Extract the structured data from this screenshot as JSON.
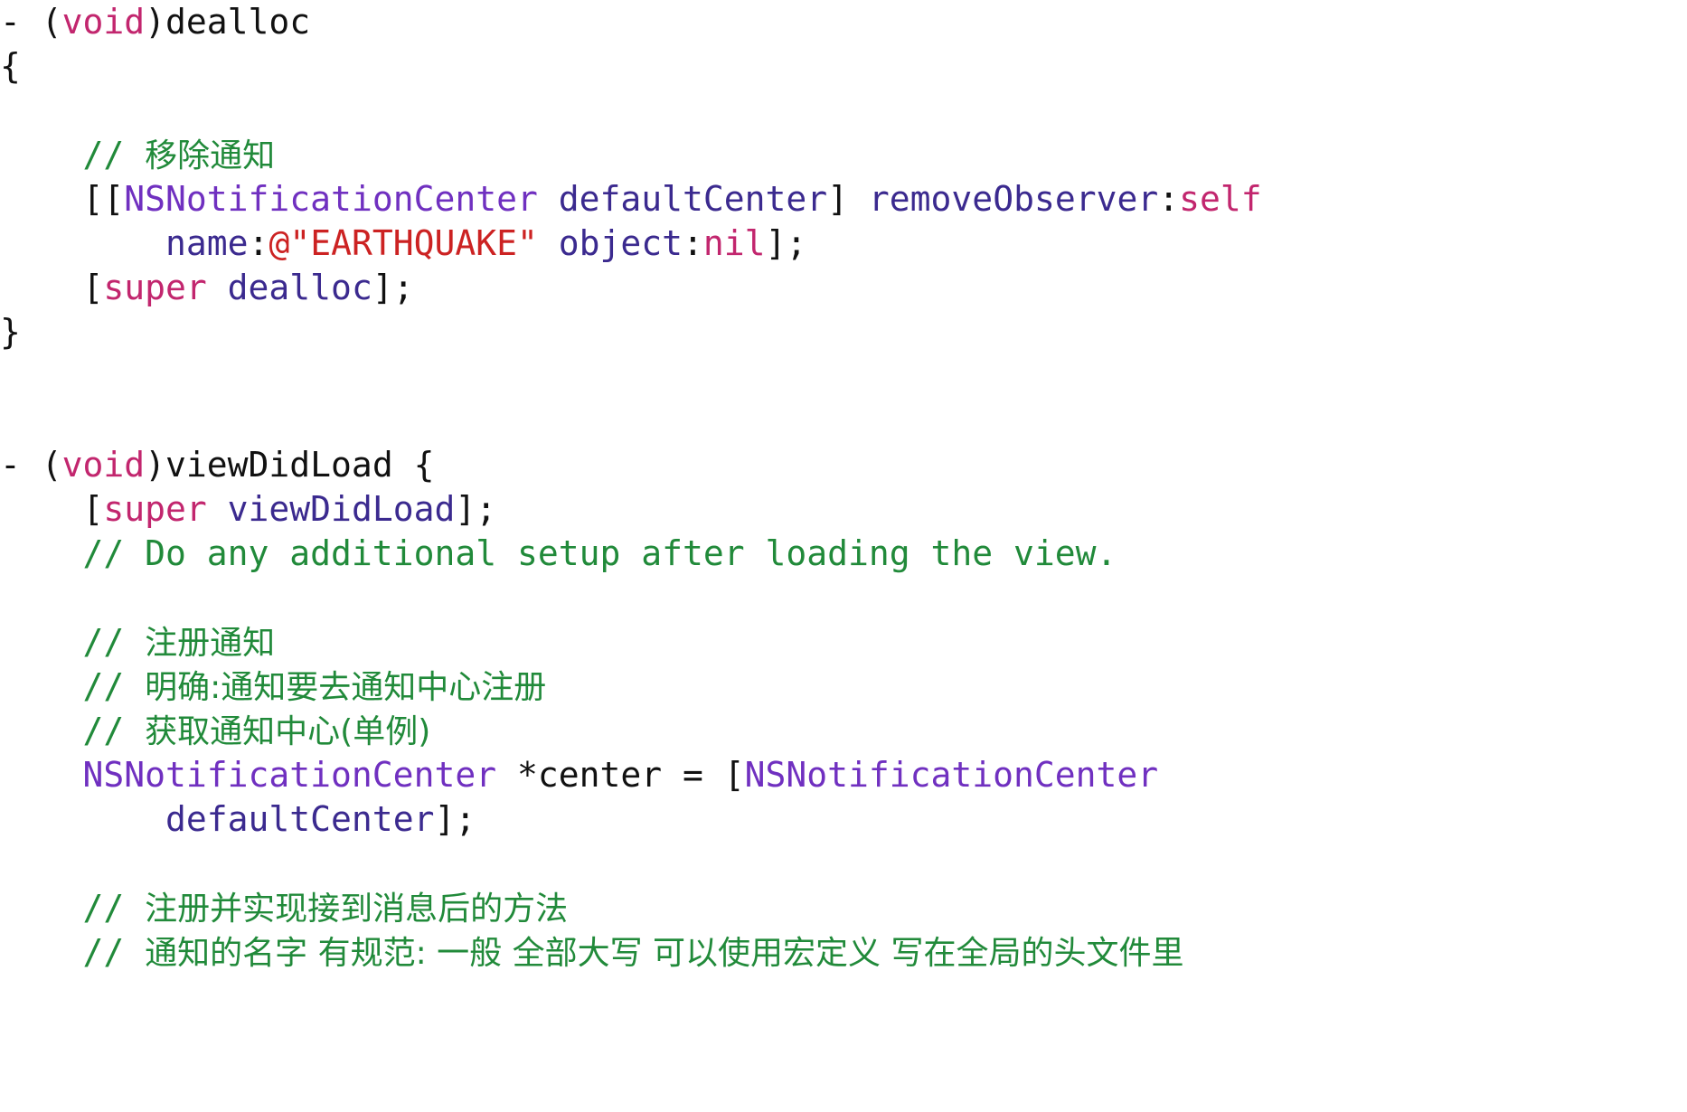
{
  "editor": {
    "language": "Objective-C",
    "background_color": "#ffffff",
    "font_size_px": 38,
    "line_height_px": 49,
    "theme_colors": {
      "keyword": "#c2266e",
      "class_name": "#7030c0",
      "method": "#3b2a8f",
      "comment": "#218a3a",
      "string": "#cc2222",
      "plain": "#111111"
    }
  },
  "code_lines": [
    {
      "index": 0,
      "indent": 0,
      "text": "- (void)dealloc",
      "tokens": [
        {
          "t": "- (",
          "c": "pl"
        },
        {
          "t": "void",
          "c": "kw"
        },
        {
          "t": ")dealloc",
          "c": "pl"
        }
      ]
    },
    {
      "index": 1,
      "indent": 0,
      "text": "{",
      "tokens": [
        {
          "t": "{",
          "c": "pl"
        }
      ]
    },
    {
      "index": 2,
      "indent": 0,
      "text": "",
      "tokens": []
    },
    {
      "index": 3,
      "indent": 4,
      "text": "    // 移除通知",
      "tokens": [
        {
          "t": "    ",
          "c": "pl"
        },
        {
          "t": "// ",
          "c": "cmt"
        },
        {
          "t": "移除通知",
          "c": "cmt-cjk"
        }
      ]
    },
    {
      "index": 4,
      "indent": 4,
      "text": "    [[NSNotificationCenter defaultCenter] removeObserver:self",
      "tokens": [
        {
          "t": "    [[",
          "c": "pl"
        },
        {
          "t": "NSNotificationCenter",
          "c": "cls"
        },
        {
          "t": " ",
          "c": "pl"
        },
        {
          "t": "defaultCenter",
          "c": "mth"
        },
        {
          "t": "] ",
          "c": "pl"
        },
        {
          "t": "removeObserver",
          "c": "mth"
        },
        {
          "t": ":",
          "c": "pl"
        },
        {
          "t": "self",
          "c": "kw"
        }
      ]
    },
    {
      "index": 5,
      "indent": 8,
      "text": "        name:@\"EARTHQUAKE\" object:nil];",
      "tokens": [
        {
          "t": "        ",
          "c": "pl"
        },
        {
          "t": "name",
          "c": "mth"
        },
        {
          "t": ":",
          "c": "pl"
        },
        {
          "t": "@\"EARTHQUAKE\"",
          "c": "str"
        },
        {
          "t": " ",
          "c": "pl"
        },
        {
          "t": "object",
          "c": "mth"
        },
        {
          "t": ":",
          "c": "pl"
        },
        {
          "t": "nil",
          "c": "kw"
        },
        {
          "t": "];",
          "c": "pl"
        }
      ]
    },
    {
      "index": 6,
      "indent": 4,
      "text": "    [super dealloc];",
      "tokens": [
        {
          "t": "    [",
          "c": "pl"
        },
        {
          "t": "super",
          "c": "kw"
        },
        {
          "t": " ",
          "c": "pl"
        },
        {
          "t": "dealloc",
          "c": "mth"
        },
        {
          "t": "];",
          "c": "pl"
        }
      ]
    },
    {
      "index": 7,
      "indent": 0,
      "text": "}",
      "tokens": [
        {
          "t": "}",
          "c": "pl"
        }
      ]
    },
    {
      "index": 8,
      "indent": 0,
      "text": "",
      "tokens": []
    },
    {
      "index": 9,
      "indent": 0,
      "text": "",
      "tokens": []
    },
    {
      "index": 10,
      "indent": 0,
      "text": "- (void)viewDidLoad {",
      "tokens": [
        {
          "t": "- (",
          "c": "pl"
        },
        {
          "t": "void",
          "c": "kw"
        },
        {
          "t": ")viewDidLoad {",
          "c": "pl"
        }
      ]
    },
    {
      "index": 11,
      "indent": 4,
      "text": "    [super viewDidLoad];",
      "tokens": [
        {
          "t": "    [",
          "c": "pl"
        },
        {
          "t": "super",
          "c": "kw"
        },
        {
          "t": " ",
          "c": "pl"
        },
        {
          "t": "viewDidLoad",
          "c": "mth"
        },
        {
          "t": "];",
          "c": "pl"
        }
      ]
    },
    {
      "index": 12,
      "indent": 4,
      "text": "    // Do any additional setup after loading the view.",
      "tokens": [
        {
          "t": "    ",
          "c": "pl"
        },
        {
          "t": "// Do any additional setup after loading the view.",
          "c": "cmt"
        }
      ]
    },
    {
      "index": 13,
      "indent": 0,
      "text": "",
      "tokens": []
    },
    {
      "index": 14,
      "indent": 4,
      "text": "    // 注册通知",
      "tokens": [
        {
          "t": "    ",
          "c": "pl"
        },
        {
          "t": "// ",
          "c": "cmt"
        },
        {
          "t": "注册通知",
          "c": "cmt-cjk"
        }
      ]
    },
    {
      "index": 15,
      "indent": 4,
      "text": "    // 明确:通知要去通知中心注册",
      "tokens": [
        {
          "t": "    ",
          "c": "pl"
        },
        {
          "t": "// ",
          "c": "cmt"
        },
        {
          "t": "明确:通知要去通知中心注册",
          "c": "cmt-cjk"
        }
      ]
    },
    {
      "index": 16,
      "indent": 4,
      "text": "    // 获取通知中心(单例)",
      "tokens": [
        {
          "t": "    ",
          "c": "pl"
        },
        {
          "t": "// ",
          "c": "cmt"
        },
        {
          "t": "获取通知中心(单例)",
          "c": "cmt-cjk"
        }
      ]
    },
    {
      "index": 17,
      "indent": 4,
      "text": "    NSNotificationCenter *center = [NSNotificationCenter",
      "tokens": [
        {
          "t": "    ",
          "c": "pl"
        },
        {
          "t": "NSNotificationCenter",
          "c": "cls"
        },
        {
          "t": " *center = [",
          "c": "pl"
        },
        {
          "t": "NSNotificationCenter",
          "c": "cls"
        }
      ]
    },
    {
      "index": 18,
      "indent": 8,
      "text": "        defaultCenter];",
      "tokens": [
        {
          "t": "        ",
          "c": "pl"
        },
        {
          "t": "defaultCenter",
          "c": "mth"
        },
        {
          "t": "];",
          "c": "pl"
        }
      ]
    },
    {
      "index": 19,
      "indent": 0,
      "text": "",
      "tokens": []
    },
    {
      "index": 20,
      "indent": 4,
      "text": "    // 注册并实现接到消息后的方法",
      "tokens": [
        {
          "t": "    ",
          "c": "pl"
        },
        {
          "t": "// ",
          "c": "cmt"
        },
        {
          "t": "注册并实现接到消息后的方法",
          "c": "cmt-cjk"
        }
      ]
    },
    {
      "index": 21,
      "indent": 4,
      "text": "    // 通知的名字 有规范: 一般 全部大写 可以使用宏定义 写在全局的头文件里",
      "tokens": [
        {
          "t": "    ",
          "c": "pl"
        },
        {
          "t": "// ",
          "c": "cmt"
        },
        {
          "t": "通知的名字 有规范: 一般 全部大写 可以使用宏定义 写在全局的头文件里",
          "c": "cmt-cjk"
        }
      ]
    }
  ]
}
